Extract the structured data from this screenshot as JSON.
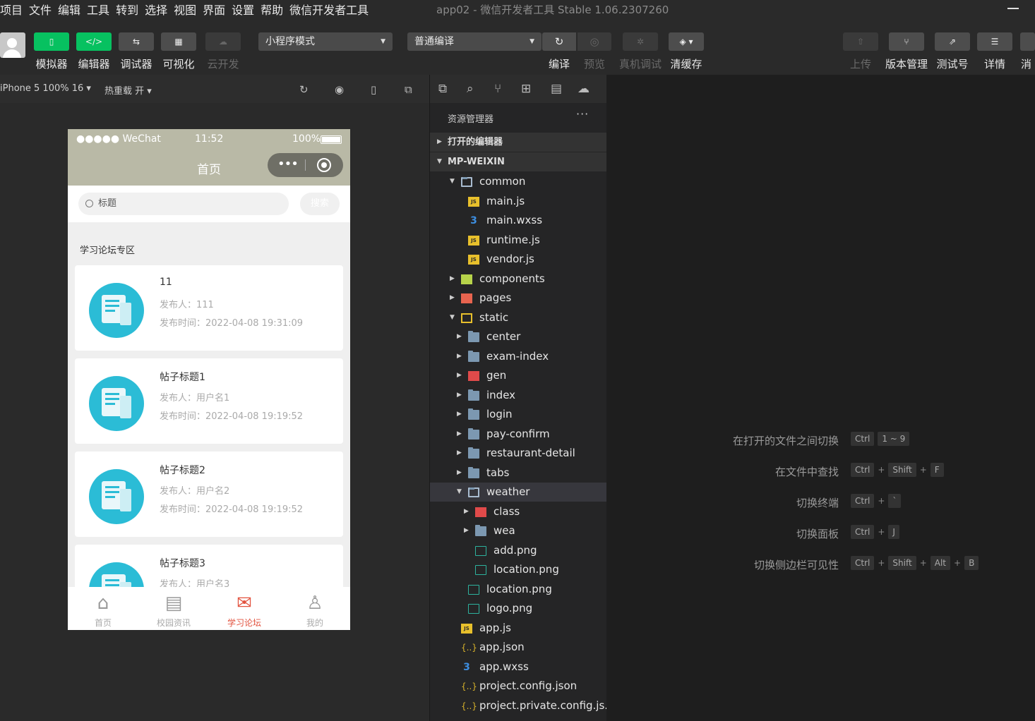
{
  "menubar": {
    "items": [
      "项目",
      "文件",
      "编辑",
      "工具",
      "转到",
      "选择",
      "视图",
      "界面",
      "设置",
      "帮助",
      "微信开发者工具"
    ],
    "window_title": "app02 - 微信开发者工具 Stable 1.06.2307260"
  },
  "toolbar": {
    "simulator": "模拟器",
    "editor": "编辑器",
    "debugger": "调试器",
    "visual": "可视化",
    "cloud": "云开发",
    "mode_select": "小程序模式",
    "compile_select": "普通编译",
    "compile": "编译",
    "preview": "预览",
    "remote_debug": "真机调试",
    "clear_cache": "清缓存",
    "upload": "上传",
    "version": "版本管理",
    "test_account": "测试号",
    "details": "详情",
    "message": "消"
  },
  "simbar": {
    "device": "iPhone 5 100% 16 ▾",
    "hot_reload": "热重载 开 ▾"
  },
  "phone": {
    "carrier": "●●●●● WeChat",
    "time": "11:52",
    "battery": "100%",
    "nav_title": "首页",
    "search_placeholder": "标题",
    "search_button": "搜索",
    "section_title": "学习论坛专区",
    "posts": [
      {
        "title": "11",
        "author": "发布人：111",
        "time": "发布时间：2022-04-08 19:31:09"
      },
      {
        "title": "帖子标题1",
        "author": "发布人：用户名1",
        "time": "发布时间：2022-04-08 19:19:52"
      },
      {
        "title": "帖子标题2",
        "author": "发布人：用户名2",
        "time": "发布时间：2022-04-08 19:19:52"
      },
      {
        "title": "帖子标题3",
        "author": "发布人：用户名3",
        "time": ""
      }
    ],
    "tabs": [
      {
        "label": "首页",
        "icon": "home-icon"
      },
      {
        "label": "校园资讯",
        "icon": "news-icon"
      },
      {
        "label": "学习论坛",
        "icon": "forum-icon"
      },
      {
        "label": "我的",
        "icon": "user-icon"
      }
    ]
  },
  "explorer": {
    "header": "资源管理器",
    "open_editors": "打开的编辑器",
    "project": "MP-WEIXIN",
    "tree": [
      {
        "name": "common",
        "type": "folder-open",
        "depth": 0,
        "expanded": true
      },
      {
        "name": "main.js",
        "type": "js",
        "depth": 1
      },
      {
        "name": "main.wxss",
        "type": "css",
        "depth": 1
      },
      {
        "name": "runtime.js",
        "type": "js",
        "depth": 1
      },
      {
        "name": "vendor.js",
        "type": "js",
        "depth": 1
      },
      {
        "name": "components",
        "type": "comp",
        "depth": 0,
        "expanded": false
      },
      {
        "name": "pages",
        "type": "pages",
        "depth": 0,
        "expanded": false
      },
      {
        "name": "static",
        "type": "static",
        "depth": 0,
        "expanded": true
      },
      {
        "name": "center",
        "type": "folder",
        "depth": 1,
        "expanded": false
      },
      {
        "name": "exam-index",
        "type": "folder",
        "depth": 1,
        "expanded": false
      },
      {
        "name": "gen",
        "type": "red",
        "depth": 1,
        "expanded": false
      },
      {
        "name": "index",
        "type": "folder",
        "depth": 1,
        "expanded": false
      },
      {
        "name": "login",
        "type": "folder",
        "depth": 1,
        "expanded": false
      },
      {
        "name": "pay-confirm",
        "type": "folder",
        "depth": 1,
        "expanded": false
      },
      {
        "name": "restaurant-detail",
        "type": "folder",
        "depth": 1,
        "expanded": false
      },
      {
        "name": "tabs",
        "type": "folder",
        "depth": 1,
        "expanded": false
      },
      {
        "name": "weather",
        "type": "folder-open",
        "depth": 1,
        "expanded": true,
        "selected": true
      },
      {
        "name": "class",
        "type": "red",
        "depth": 2,
        "expanded": false
      },
      {
        "name": "wea",
        "type": "folder",
        "depth": 2,
        "expanded": false
      },
      {
        "name": "add.png",
        "type": "img",
        "depth": 2
      },
      {
        "name": "location.png",
        "type": "img",
        "depth": 2
      },
      {
        "name": "location.png",
        "type": "img",
        "depth": 1
      },
      {
        "name": "logo.png",
        "type": "img",
        "depth": 1
      },
      {
        "name": "app.js",
        "type": "js",
        "depth": 0
      },
      {
        "name": "app.json",
        "type": "json",
        "depth": 0
      },
      {
        "name": "app.wxss",
        "type": "css",
        "depth": 0
      },
      {
        "name": "project.config.json",
        "type": "json",
        "depth": 0
      },
      {
        "name": "project.private.config.js...",
        "type": "json",
        "depth": 0
      }
    ]
  },
  "shortcuts": [
    {
      "label": "在打开的文件之间切换",
      "keys": [
        "Ctrl",
        "1 ~ 9"
      ],
      "joined": false
    },
    {
      "label": "在文件中查找",
      "keys": [
        "Ctrl",
        "Shift",
        "F"
      ],
      "joined": true
    },
    {
      "label": "切换终端",
      "keys": [
        "Ctrl",
        "`"
      ],
      "joined": true
    },
    {
      "label": "切换面板",
      "keys": [
        "Ctrl",
        "J"
      ],
      "joined": true
    },
    {
      "label": "切换侧边栏可见性",
      "keys": [
        "Ctrl",
        "Shift",
        "Alt",
        "B"
      ],
      "joined": true
    }
  ],
  "colors": {
    "accent_green": "#07c160",
    "nav_bar": "#b9b9a6",
    "post_icon": "#2bbcd6",
    "tab_active": "#e2533f"
  }
}
